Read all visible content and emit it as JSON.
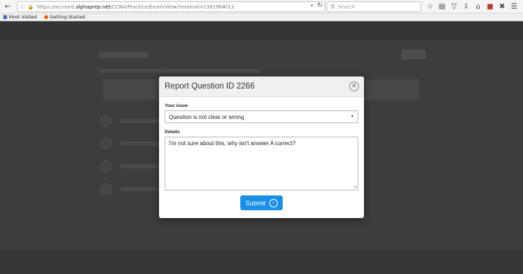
{
  "browser": {
    "url_prefix": "https://account.",
    "url_domain": "alphaprep.net",
    "url_path": "/CCNA/Practice/Exam/View/?examid=139196#/12",
    "search_placeholder": "Search",
    "bookmarks": [
      {
        "label": "Most Visited",
        "icon": "folder-icon"
      },
      {
        "label": "Getting Started",
        "icon": "firefox-icon"
      }
    ]
  },
  "modal": {
    "title": "Report Question ID 2266",
    "issue_label": "Your issue",
    "issue_value": "Question is not clear or wrong",
    "details_label": "Details",
    "details_value": "I'm not sure about this, why isn't answer A correct?",
    "submit_label": "Submit"
  }
}
